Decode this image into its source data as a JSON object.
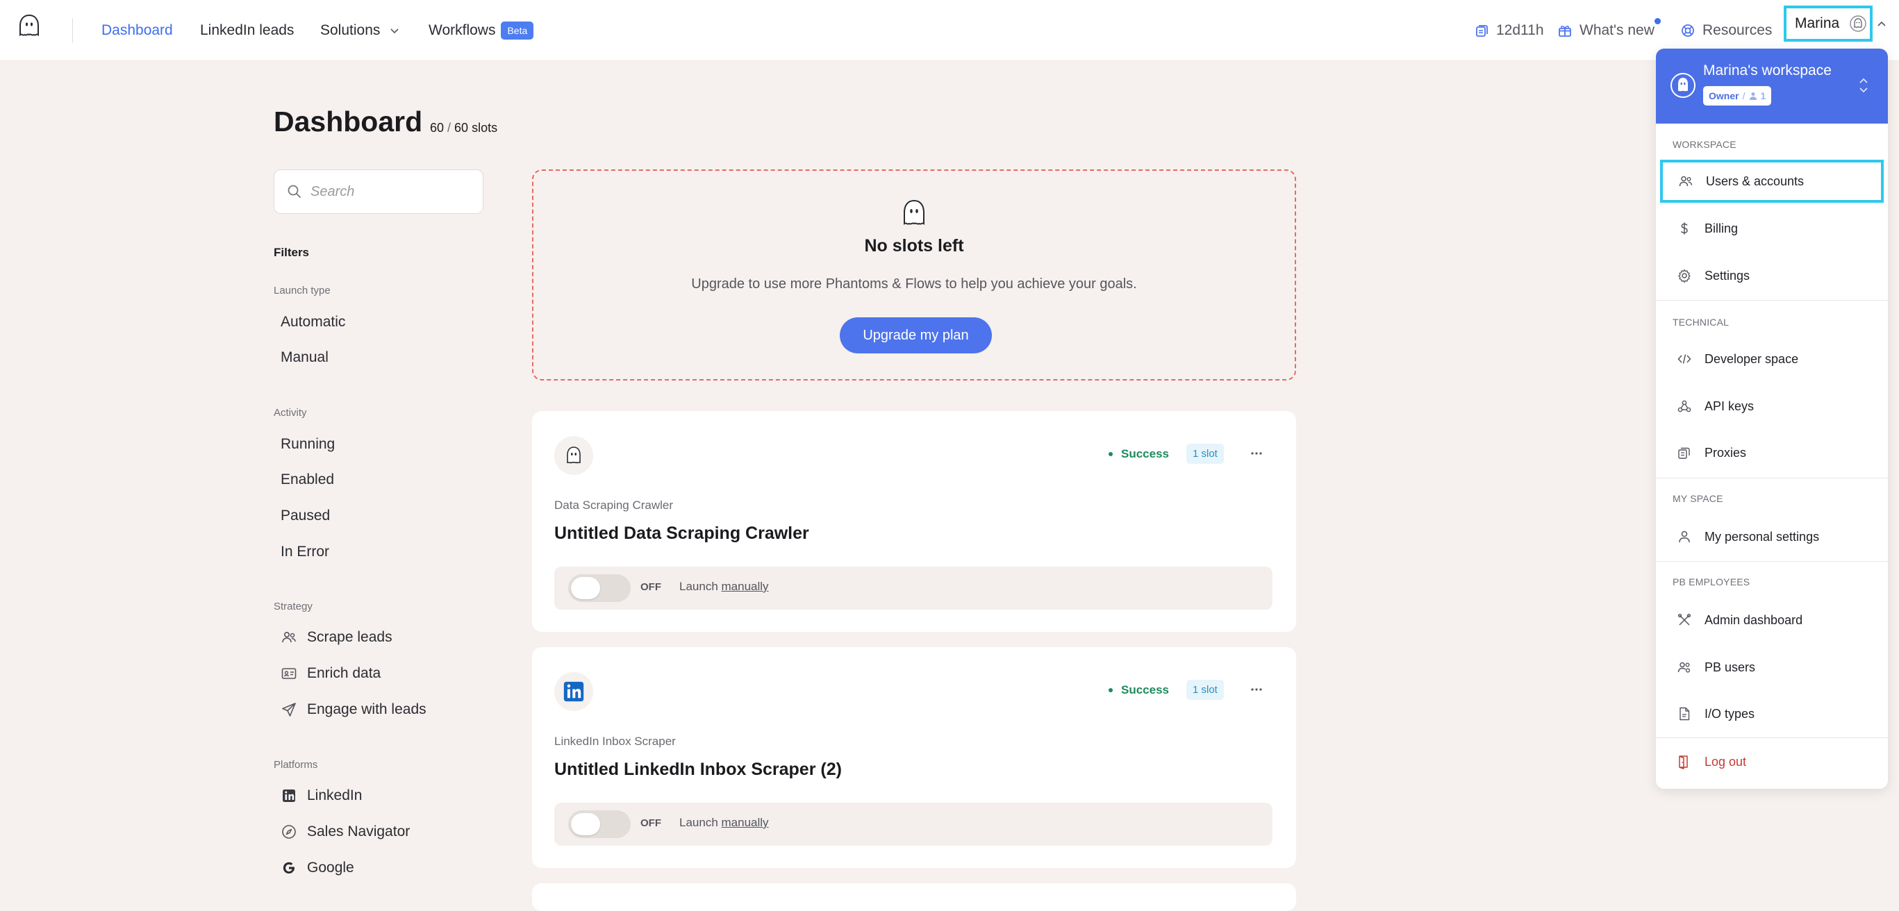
{
  "topbar": {
    "nav": [
      {
        "label": "Dashboard",
        "active": true
      },
      {
        "label": "LinkedIn leads"
      },
      {
        "label": "Solutions"
      },
      {
        "label": "Workflows",
        "badge": "Beta"
      }
    ],
    "time_remaining": "12d11h",
    "whats_new": "What's new",
    "resources": "Resources",
    "user_name": "Marina"
  },
  "page": {
    "title": "Dashboard",
    "slots_used": "60",
    "slots_sep": " / ",
    "slots_total": "60 slots"
  },
  "sidebar": {
    "search_placeholder": "Search",
    "filters_title": "Filters",
    "launch_type_label": "Launch type",
    "launch_types": [
      "Automatic",
      "Manual"
    ],
    "activity_label": "Activity",
    "activity": [
      "Running",
      "Enabled",
      "Paused",
      "In Error"
    ],
    "strategy_label": "Strategy",
    "strategy": [
      {
        "label": "Scrape leads",
        "icon": "users-icon"
      },
      {
        "label": "Enrich data",
        "icon": "id-card-icon"
      },
      {
        "label": "Engage with leads",
        "icon": "send-icon"
      }
    ],
    "platforms_label": "Platforms",
    "platforms": [
      {
        "label": "LinkedIn",
        "icon": "linkedin-icon"
      },
      {
        "label": "Sales Navigator",
        "icon": "compass-icon"
      },
      {
        "label": "Google",
        "icon": "google-icon"
      }
    ]
  },
  "no_slots": {
    "title": "No slots left",
    "description": "Upgrade to use more Phantoms & Flows to help you achieve your goals.",
    "button": "Upgrade my plan"
  },
  "phantoms": [
    {
      "type": "Data Scraping Crawler",
      "name": "Untitled Data Scraping Crawler",
      "status": "Success",
      "slot": "1 slot",
      "toggle": "OFF",
      "launch_prefix": "Launch ",
      "launch_link": "manually",
      "icon": "ghost-icon"
    },
    {
      "type": "LinkedIn Inbox Scraper",
      "name": "Untitled LinkedIn Inbox Scraper (2)",
      "status": "Success",
      "slot": "1 slot",
      "toggle": "OFF",
      "launch_prefix": "Launch ",
      "launch_link": "manually",
      "icon": "linkedin-icon"
    }
  ],
  "dropdown": {
    "workspace_name": "Marina's workspace",
    "role": "Owner",
    "member_count": "1",
    "sections": [
      {
        "label": "WORKSPACE",
        "items": [
          "Users & accounts",
          "Billing",
          "Settings"
        ]
      },
      {
        "label": "TECHNICAL",
        "items": [
          "Developer space",
          "API keys",
          "Proxies"
        ]
      },
      {
        "label": "MY SPACE",
        "items": [
          "My personal settings"
        ]
      },
      {
        "label": "PB EMPLOYEES",
        "items": [
          "Admin dashboard",
          "PB users",
          "I/O types"
        ]
      }
    ],
    "logout": "Log out"
  },
  "colors": {
    "accent": "#3d6ef0",
    "workspace_header": "#4b6fe6",
    "success": "#1e8a5e",
    "danger": "#c43a31",
    "dashed_border": "#e26b62",
    "highlight": "#2fc8ee"
  }
}
